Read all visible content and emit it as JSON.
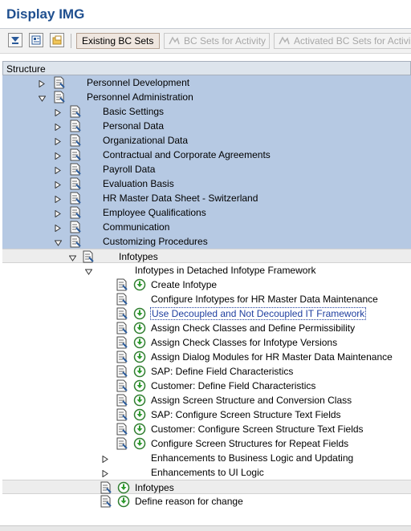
{
  "title": "Display IMG",
  "toolbar": {
    "existing_bc_sets": "Existing BC Sets",
    "bc_sets_for_activity": "BC Sets for Activity",
    "activated_bc_sets": "Activated BC Sets for Activi"
  },
  "tree": {
    "header": "Structure",
    "items": [
      {
        "label": "Personnel Development"
      },
      {
        "label": "Personnel Administration"
      },
      {
        "label": "Basic Settings"
      },
      {
        "label": "Personal Data"
      },
      {
        "label": "Organizational Data"
      },
      {
        "label": "Contractual and Corporate Agreements"
      },
      {
        "label": "Payroll Data"
      },
      {
        "label": "Evaluation Basis"
      },
      {
        "label": "HR Master Data Sheet - Switzerland"
      },
      {
        "label": "Employee Qualifications"
      },
      {
        "label": "Communication"
      },
      {
        "label": "Customizing Procedures"
      },
      {
        "label": "Infotypes"
      },
      {
        "label": "Infotypes in Detached Infotype Framework"
      },
      {
        "label": "Create Infotype"
      },
      {
        "label": "Configure Infotypes for HR Master Data Maintenance"
      },
      {
        "label": "Use Decoupled and Not Decoupled IT Framework"
      },
      {
        "label": "Assign Check Classes and Define Permissibility"
      },
      {
        "label": "Assign Check Classes for Infotype Versions"
      },
      {
        "label": "Assign Dialog Modules for HR Master Data Maintenance"
      },
      {
        "label": "SAP: Define Field Characteristics"
      },
      {
        "label": "Customer: Define Field Characteristics"
      },
      {
        "label": "Assign Screen Structure and Conversion Class"
      },
      {
        "label": "SAP: Configure Screen Structure Text Fields"
      },
      {
        "label": "Customer: Configure Screen Structure Text Fields"
      },
      {
        "label": "Configure Screen Structures for Repeat Fields"
      },
      {
        "label": "Enhancements to Business Logic and Updating"
      },
      {
        "label": "Enhancements to UI Logic"
      },
      {
        "label": "Infotypes"
      },
      {
        "label": "Define reason for change"
      }
    ]
  },
  "colors": {
    "title": "#1f4f8f",
    "selected_row": "#b6c9e3",
    "link": "#1f3f9f",
    "execute_icon": "#2e9b2e"
  }
}
